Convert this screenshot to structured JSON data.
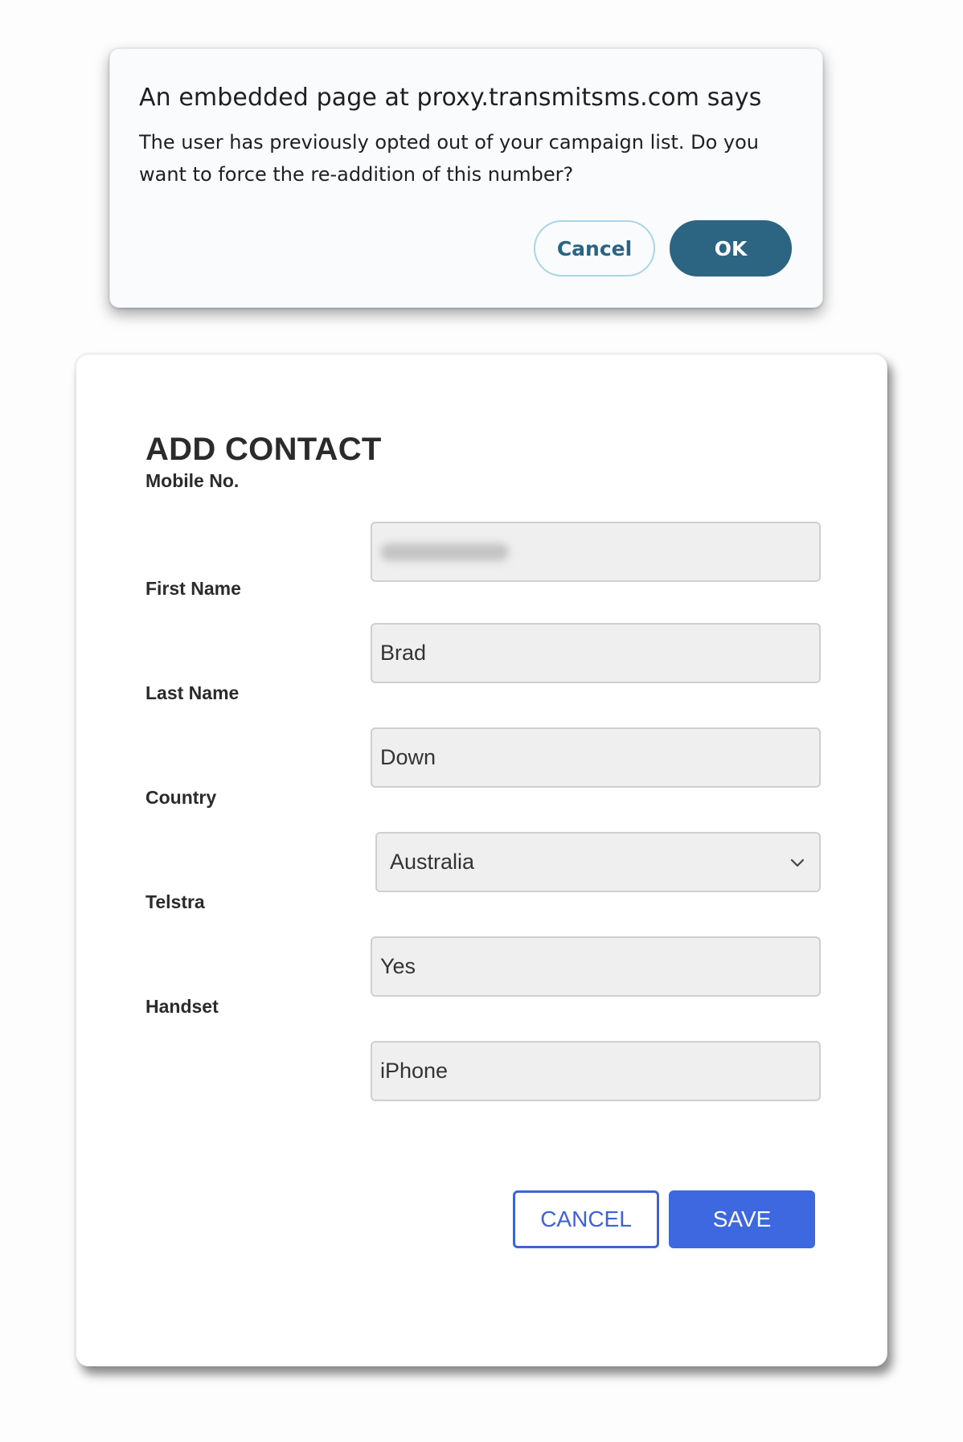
{
  "alert": {
    "title": "An embedded page at proxy.transmitsms.com says",
    "message": "The user has previously opted out of your campaign list. Do you want to force the re-addition of this number?",
    "cancel_label": "Cancel",
    "ok_label": "OK"
  },
  "form": {
    "title": "ADD CONTACT",
    "fields": {
      "mobile": {
        "label": "Mobile No.",
        "value": ""
      },
      "first_name": {
        "label": "First Name",
        "value": "Brad"
      },
      "last_name": {
        "label": "Last Name",
        "value": "Down"
      },
      "country": {
        "label": "Country",
        "value": "Australia"
      },
      "telstra": {
        "label": "Telstra",
        "value": "Yes"
      },
      "handset": {
        "label": "Handset",
        "value": "iPhone"
      }
    },
    "cancel_label": "CANCEL",
    "save_label": "SAVE"
  },
  "colors": {
    "dialog_ok": "#2c6582",
    "dialog_cancel_border": "#a9d6e6",
    "save_button": "#3e68e0",
    "field_background": "#efefef"
  },
  "icons": {
    "select_arrow": "chevron-down-icon"
  }
}
